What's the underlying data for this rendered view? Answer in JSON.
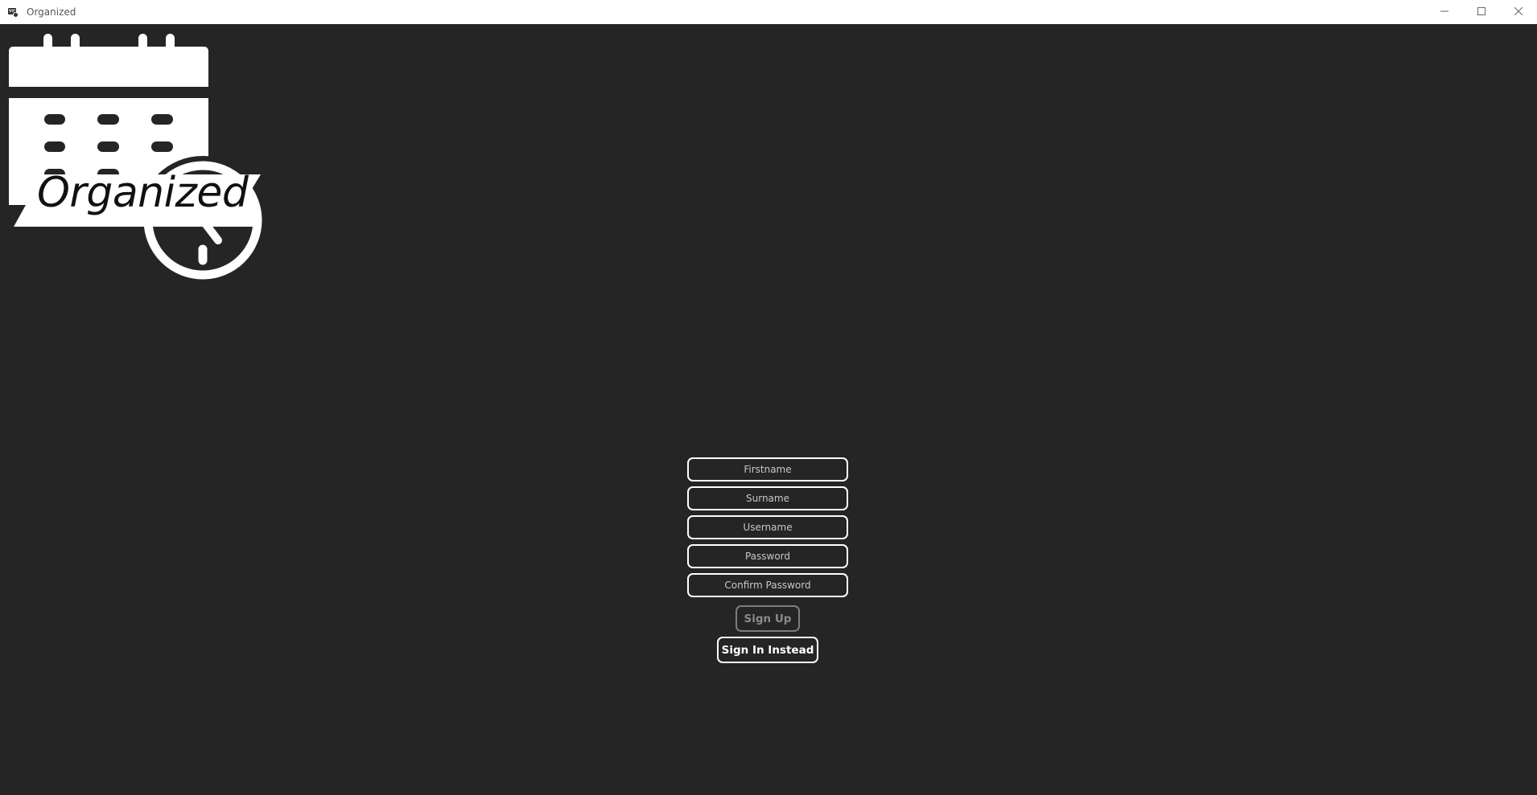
{
  "window": {
    "title": "Organized",
    "icon": "app-calendar-icon",
    "controls": [
      "minimize-icon",
      "maximize-icon",
      "close-icon"
    ]
  },
  "logo": {
    "text": "Organized",
    "icons": [
      "calendar-icon",
      "clock-icon"
    ]
  },
  "form": {
    "firstname_placeholder": "Firstname",
    "surname_placeholder": "Surname",
    "username_placeholder": "Username",
    "password_placeholder": "Password",
    "confirm_password_placeholder": "Confirm Password",
    "signup_label": "Sign Up",
    "signin_label": "Sign In Instead"
  },
  "colors": {
    "background": "#252525",
    "foreground": "#ffffff",
    "disabled": "#7d7d7d"
  }
}
